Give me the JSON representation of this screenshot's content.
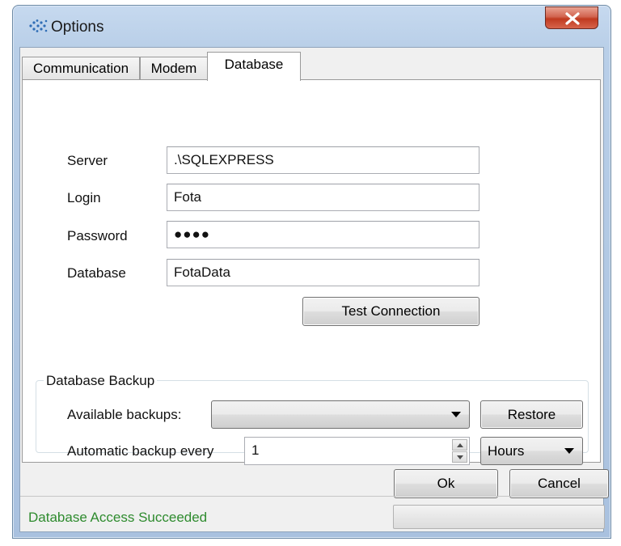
{
  "window": {
    "title": "Options",
    "close_icon": "close-icon"
  },
  "tabs": [
    {
      "label": "Communication",
      "active": false
    },
    {
      "label": "Modem",
      "active": false
    },
    {
      "label": "Database",
      "active": true
    }
  ],
  "database": {
    "server_label": "Server",
    "server_value": ".\\SQLEXPRESS",
    "login_label": "Login",
    "login_value": "Fota",
    "password_label": "Password",
    "password_value": "●●●●",
    "database_label": "Database",
    "database_value": "FotaData",
    "test_connection_label": "Test Connection"
  },
  "backup": {
    "group_title": "Database Backup",
    "available_label": "Available backups:",
    "available_selected": "",
    "restore_label": "Restore",
    "auto_label": "Automatic backup every",
    "auto_value": "1",
    "unit_selected": "Hours"
  },
  "footer": {
    "ok_label": "Ok",
    "cancel_label": "Cancel",
    "status_text": "Database Access Succeeded",
    "status_color": "#2e8b2e",
    "progress": 0
  }
}
